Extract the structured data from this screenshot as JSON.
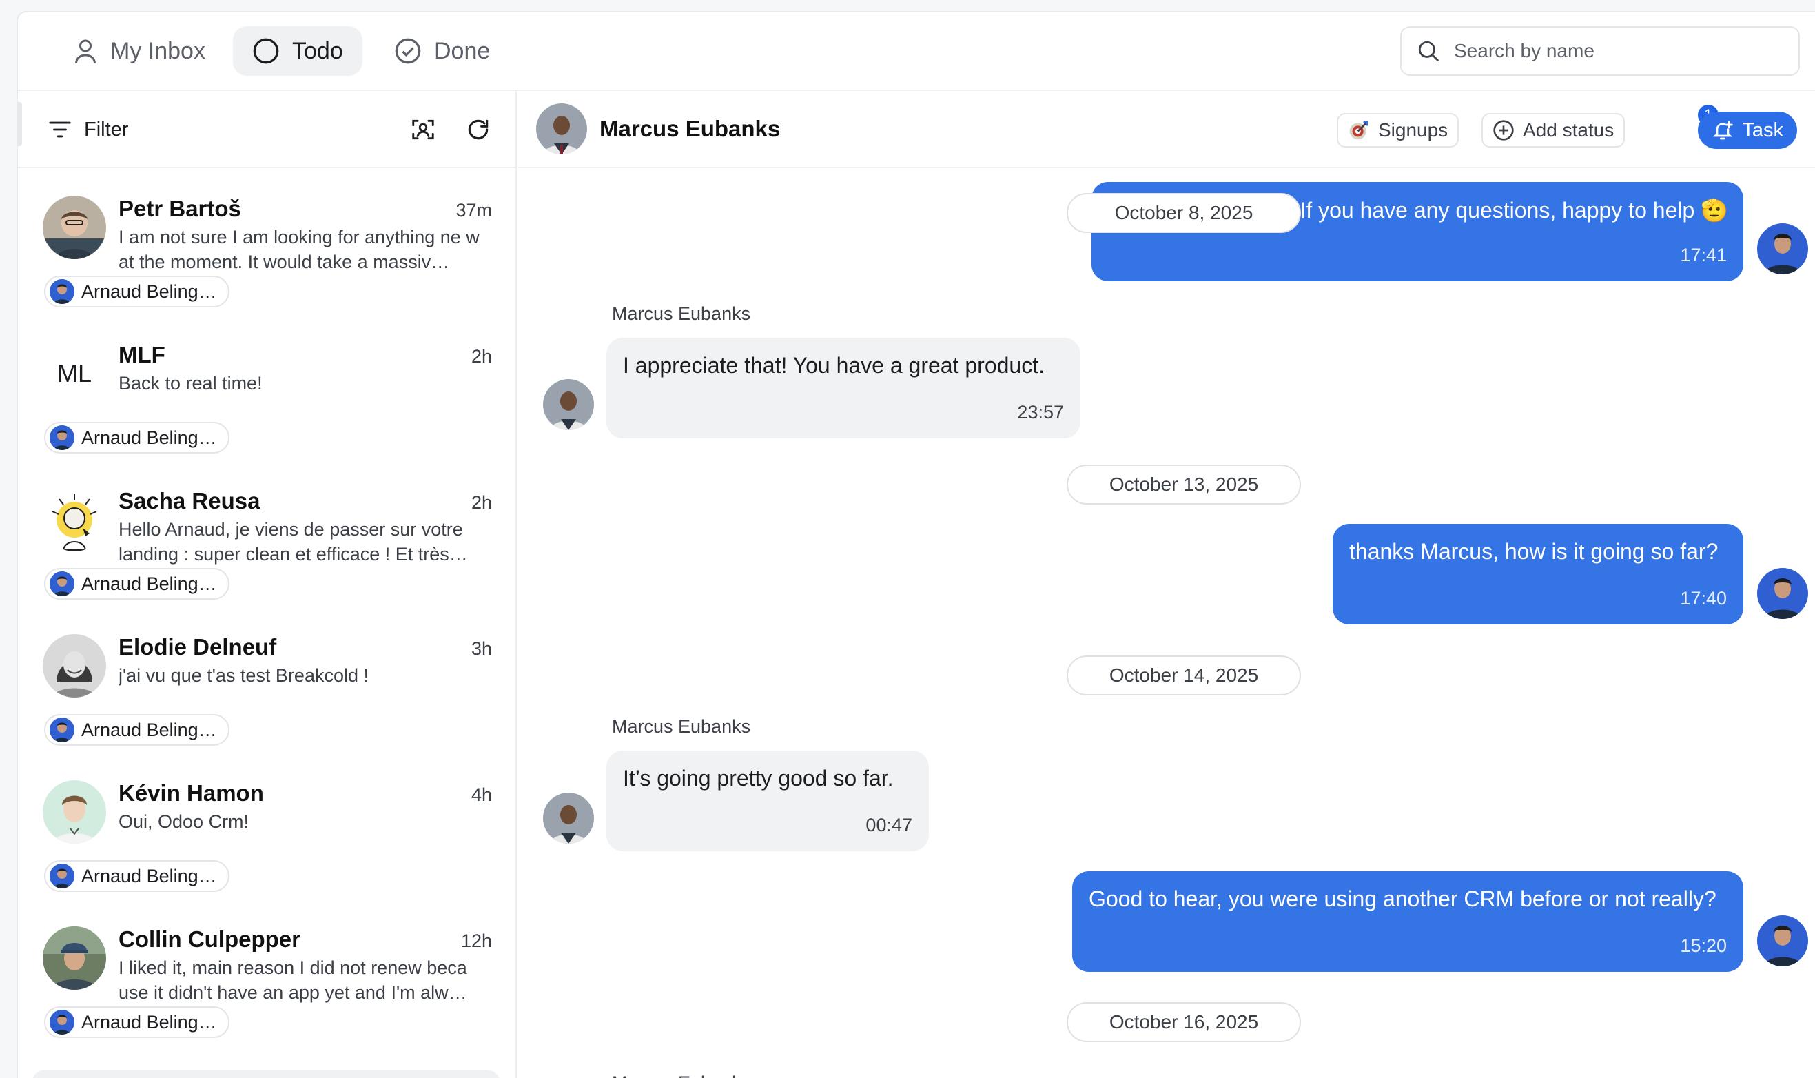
{
  "tabs": [
    {
      "label": "My Inbox",
      "icon": "user-icon"
    },
    {
      "label": "Todo",
      "icon": "circle-icon"
    },
    {
      "label": "Done",
      "icon": "check-circle-icon"
    }
  ],
  "search": {
    "placeholder": "Search by name"
  },
  "sidebar": {
    "filter_label": "Filter",
    "conversations": [
      {
        "name": "Petr Bartoš",
        "time": "37m",
        "preview": "I am not sure I am looking for anything ne w at the moment. It would take a massiv…",
        "owner": "Arnaud Beling…",
        "avatar": "photo"
      },
      {
        "name": "MLF",
        "time": "2h",
        "preview": "Back to real time!",
        "owner": "Arnaud Beling…",
        "avatar_initials": "ML"
      },
      {
        "name": "Sacha Reusa",
        "time": "2h",
        "preview": "Hello Arnaud, je viens de passer sur votre landing : super clean et efficace ! Et très…",
        "owner": "Arnaud Beling…",
        "avatar": "illustration"
      },
      {
        "name": "Elodie Delneuf",
        "time": "3h",
        "preview": "j'ai vu que t'as test Breakcold !",
        "owner": "Arnaud Beling…",
        "avatar": "photo"
      },
      {
        "name": "Kévin Hamon",
        "time": "4h",
        "preview": "Oui, Odoo Crm!",
        "owner": "Arnaud Beling…",
        "avatar": "photo"
      },
      {
        "name": "Collin Culpepper",
        "time": "12h",
        "preview": "I liked it, main reason I did not renew beca use it didn't have an app yet and I'm alw…",
        "owner": "Arnaud Beling…",
        "avatar": "photo"
      }
    ]
  },
  "chat": {
    "contact_name": "Marcus Eubanks",
    "status_label": "Signups",
    "add_status_label": "Add status",
    "add_status_badge": "1",
    "task_label": "Task",
    "messages": [
      {
        "type": "date",
        "label": "October 8, 2025"
      },
      {
        "type": "out",
        "text": "If you have any questions, happy to help 🫡",
        "time": "17:41"
      },
      {
        "type": "in",
        "sender": "Marcus Eubanks",
        "text": "I appreciate that! You have a great product.",
        "time": "23:57"
      },
      {
        "type": "date",
        "label": "October 13, 2025"
      },
      {
        "type": "out",
        "text": "thanks Marcus, how is it going so far?",
        "time": "17:40"
      },
      {
        "type": "date",
        "label": "October 14, 2025"
      },
      {
        "type": "in",
        "sender": "Marcus Eubanks",
        "text": "It’s going pretty good so far.",
        "time": "00:47"
      },
      {
        "type": "out",
        "text": "Good to hear, you were using another CRM before or not really?",
        "time": "15:20"
      },
      {
        "type": "date",
        "label": "October 16, 2025"
      },
      {
        "type": "in",
        "sender": "Marcus Eubanks"
      }
    ]
  },
  "colors": {
    "accent": "#2c6ee8",
    "bubble_out": "#3474e4",
    "bubble_in": "#f1f2f4"
  }
}
